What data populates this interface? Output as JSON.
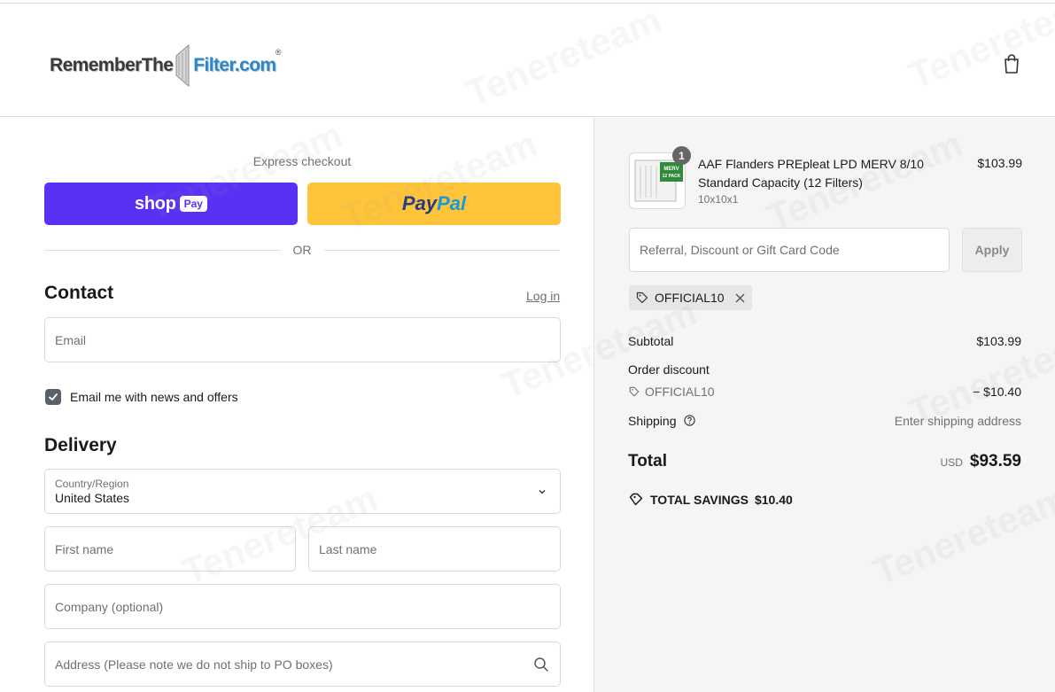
{
  "header": {
    "logo_part1": "RememberThe",
    "logo_part2": "Filter.com",
    "logo_reg": "®",
    "cart_icon": "shopping-bag-icon"
  },
  "express": {
    "title": "Express checkout",
    "shop_pay_word": "shop",
    "shop_pay_pill": "Pay",
    "paypal_a": "Pay",
    "paypal_b": "Pal",
    "or_text": "OR"
  },
  "contact": {
    "title": "Contact",
    "login_link": "Log in",
    "email_placeholder": "Email",
    "newsletter_label": "Email me with news and offers",
    "newsletter_checked": true
  },
  "delivery": {
    "title": "Delivery",
    "country_label": "Country/Region",
    "country_value": "United States",
    "first_name_placeholder": "First name",
    "last_name_placeholder": "Last name",
    "company_placeholder": "Company (optional)",
    "address_placeholder": "Address (Please note we do not ship to PO boxes)"
  },
  "summary": {
    "item": {
      "quantity": "1",
      "title": "AAF Flanders PREpleat LPD MERV 8/10 Standard Capacity (12 Filters)",
      "variant": "10x10x1",
      "price": "$103.99",
      "thumb_badge_line1": "MERV",
      "thumb_badge_line2": "12 PACK"
    },
    "discount_placeholder": "Referral, Discount or Gift Card Code",
    "apply_label": "Apply",
    "applied_code": "OFFICIAL10",
    "subtotal_label": "Subtotal",
    "subtotal_value": "$103.99",
    "order_discount_label": "Order discount",
    "order_discount_code": "OFFICIAL10",
    "order_discount_value": "− $10.40",
    "shipping_label": "Shipping",
    "shipping_value": "Enter shipping address",
    "total_label": "Total",
    "total_currency": "USD",
    "total_value": "$93.59",
    "savings_label": "TOTAL SAVINGS",
    "savings_value": "$10.40"
  },
  "watermark_text": "Tenereteam",
  "colors": {
    "shop_pay": "#5a31f4",
    "paypal": "#ffc439",
    "checkbox": "#58616a",
    "sidebar_bg": "#f5f5f5"
  }
}
